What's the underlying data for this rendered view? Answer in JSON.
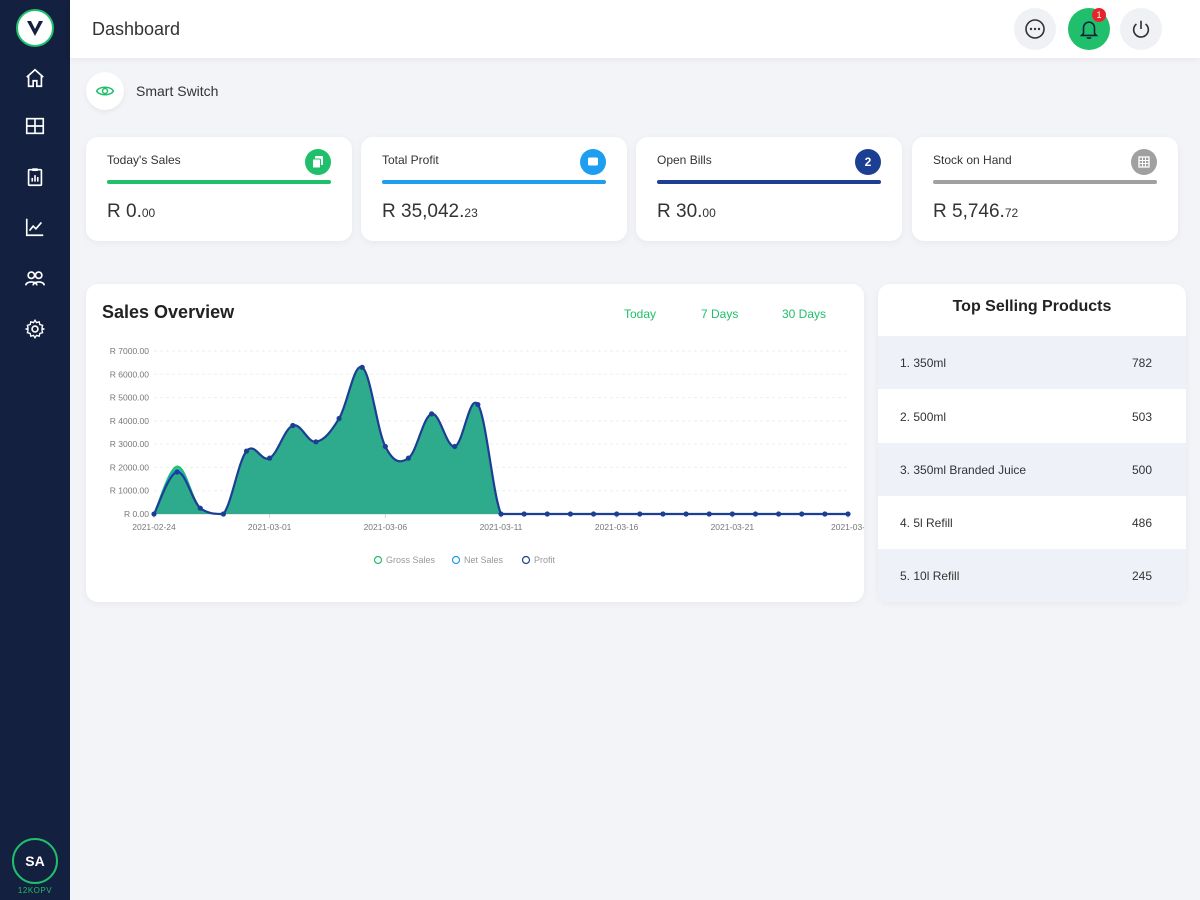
{
  "header": {
    "title": "Dashboard",
    "notification_count": "1"
  },
  "sidebar": {
    "items": [
      {
        "icon": "home-icon"
      },
      {
        "icon": "layout-icon"
      },
      {
        "icon": "clipboard-icon"
      },
      {
        "icon": "chart-icon"
      },
      {
        "icon": "users-icon"
      },
      {
        "icon": "gear-icon"
      }
    ],
    "avatar": {
      "initials": "SA",
      "sub": "12KOPV"
    }
  },
  "smart_switch": {
    "label": "Smart Switch"
  },
  "cards": [
    {
      "label": "Today's Sales",
      "value": "R 0.",
      "decimals": "00",
      "color": "#1fbf6b",
      "icon": "copy-icon",
      "badge": ""
    },
    {
      "label": "Total Profit",
      "value": "R 35,042.",
      "decimals": "23",
      "color": "#1e9ef0",
      "icon": "chat-icon",
      "badge": ""
    },
    {
      "label": "Open Bills",
      "value": "R 30.",
      "decimals": "00",
      "color": "#1c3f94",
      "icon": "count-badge-icon",
      "badge": "2"
    },
    {
      "label": "Stock on Hand",
      "value": "R 5,746.",
      "decimals": "72",
      "color": "#a0a0a0",
      "icon": "grid-icon",
      "badge": ""
    }
  ],
  "sales_overview": {
    "title": "Sales Overview",
    "tabs": [
      "Today",
      "7 Days",
      "30 Days"
    ]
  },
  "chart_data": {
    "type": "line",
    "x": [
      "2021-02-24",
      "2021-02-25",
      "2021-02-26",
      "2021-02-27",
      "2021-02-28",
      "2021-03-01",
      "2021-03-02",
      "2021-03-03",
      "2021-03-04",
      "2021-03-05",
      "2021-03-06",
      "2021-03-07",
      "2021-03-08",
      "2021-03-09",
      "2021-03-10",
      "2021-03-11",
      "2021-03-12",
      "2021-03-13",
      "2021-03-14",
      "2021-03-15",
      "2021-03-16",
      "2021-03-17",
      "2021-03-18",
      "2021-03-19",
      "2021-03-20",
      "2021-03-21",
      "2021-03-22",
      "2021-03-23",
      "2021-03-24",
      "2021-03-25",
      "2021-03-26"
    ],
    "x_tick_labels": [
      "2021-02-24",
      "2021-03-01",
      "2021-03-06",
      "2021-03-11",
      "2021-03-16",
      "2021-03-21",
      "2021-03-"
    ],
    "y_tick_labels": [
      "R 0.00",
      "R 1000.00",
      "R 2000.00",
      "R 3000.00",
      "R 4000.00",
      "R 5000.00",
      "R 6000.00",
      "R 7000.00"
    ],
    "ylim": [
      0,
      7000
    ],
    "series": [
      {
        "name": "Gross Sales",
        "color": "#1fbf6b",
        "values": [
          0,
          2050,
          250,
          0,
          2700,
          2400,
          3800,
          3100,
          4100,
          6300,
          2900,
          2400,
          4300,
          2900,
          4700,
          0,
          0,
          0,
          0,
          0,
          0,
          0,
          0,
          0,
          0,
          0,
          0,
          0,
          0,
          0,
          0
        ]
      },
      {
        "name": "Net Sales",
        "color": "#1e9ef0",
        "values": [
          0,
          1900,
          250,
          0,
          2700,
          2400,
          3800,
          3100,
          4100,
          6300,
          2900,
          2400,
          4300,
          2900,
          4700,
          0,
          0,
          0,
          0,
          0,
          0,
          0,
          0,
          0,
          0,
          0,
          0,
          0,
          0,
          0,
          0
        ]
      },
      {
        "name": "Profit",
        "color": "#1c3f94",
        "values": [
          0,
          1800,
          250,
          0,
          2700,
          2400,
          3800,
          3100,
          4100,
          6300,
          2900,
          2400,
          4300,
          2900,
          4700,
          0,
          0,
          0,
          0,
          0,
          0,
          0,
          0,
          0,
          0,
          0,
          0,
          0,
          0,
          0,
          0
        ]
      }
    ],
    "grid": true,
    "legend": "bottom"
  },
  "top_selling": {
    "title": "Top Selling Products",
    "items": [
      {
        "name": "1. 350ml",
        "qty": "782"
      },
      {
        "name": "2. 500ml",
        "qty": "503"
      },
      {
        "name": "3. 350ml Branded Juice",
        "qty": "500"
      },
      {
        "name": "4. 5l Refill",
        "qty": "486"
      },
      {
        "name": "5. 10l Refill",
        "qty": "245"
      }
    ]
  }
}
